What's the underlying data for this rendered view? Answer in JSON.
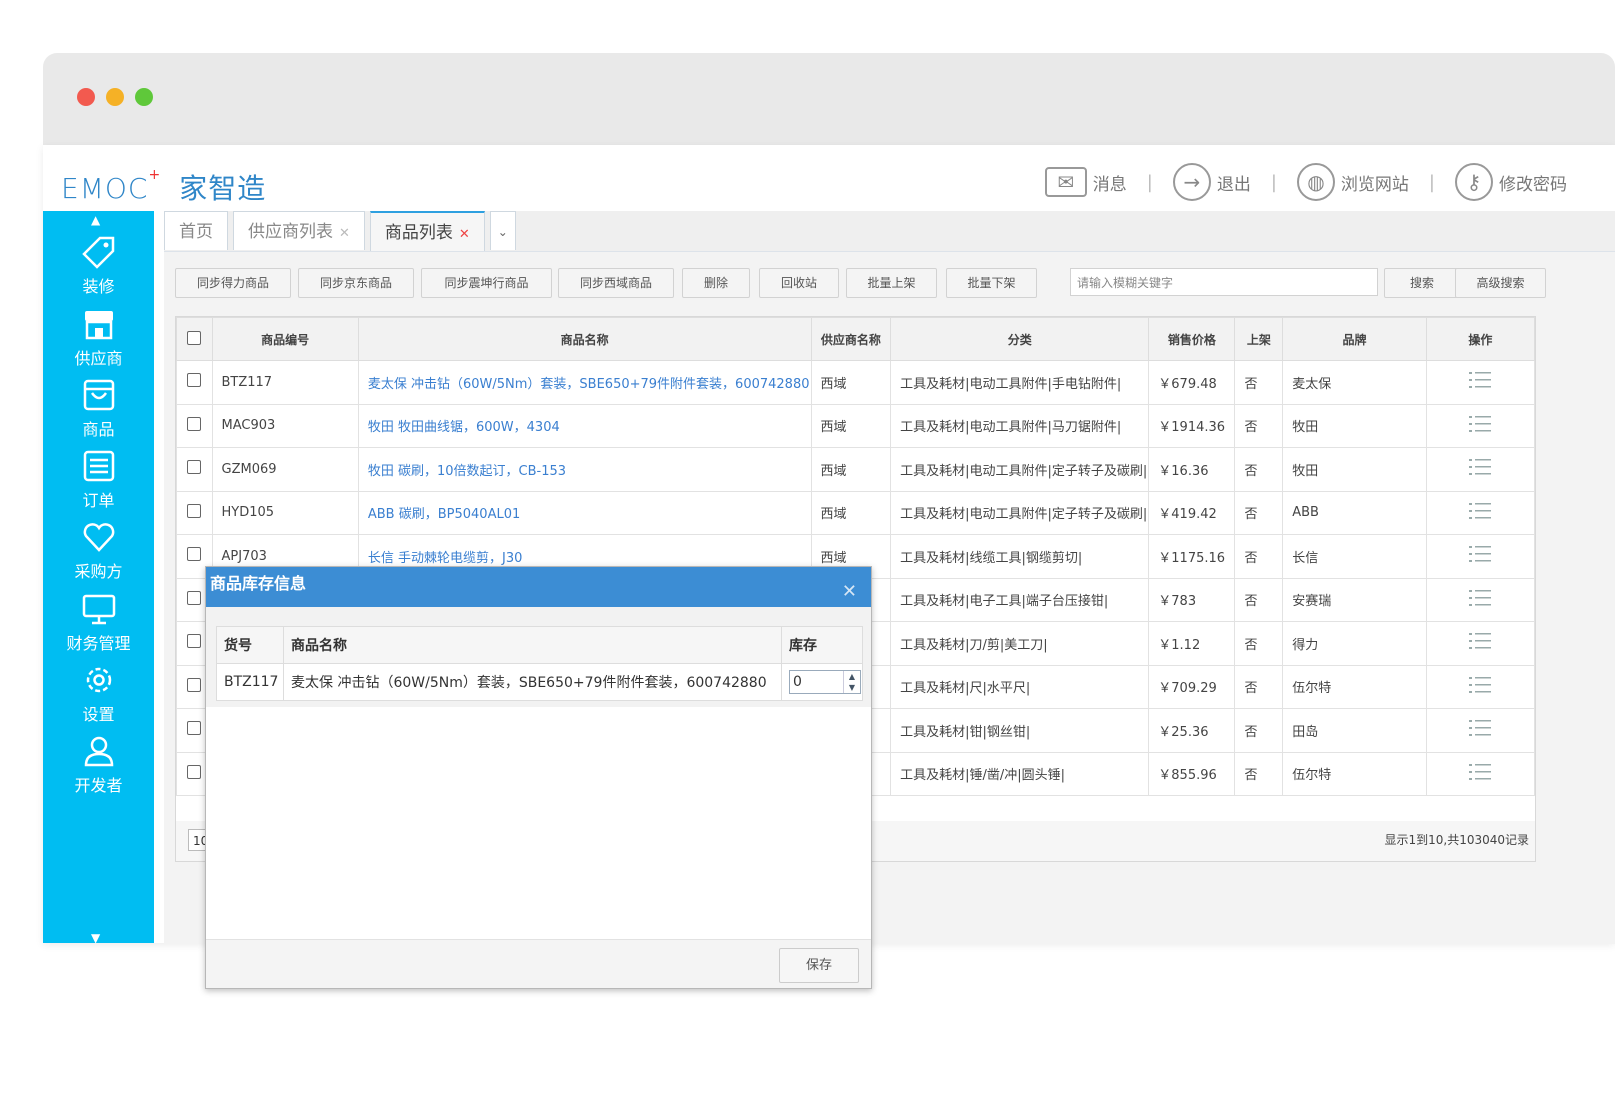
{
  "header": {
    "logo_text": "EMOC",
    "logo_cn": "家智造",
    "links": [
      {
        "label": "消息",
        "icon": "mail-icon"
      },
      {
        "label": "退出",
        "icon": "logout-icon"
      },
      {
        "label": "浏览网站",
        "icon": "dribbble-icon"
      },
      {
        "label": "修改密码",
        "icon": "key-icon"
      }
    ],
    "separator": "|"
  },
  "sidebar": {
    "items": [
      {
        "label": "装修",
        "icon": "tag-icon"
      },
      {
        "label": "供应商",
        "icon": "store-icon"
      },
      {
        "label": "商品",
        "icon": "bag-icon"
      },
      {
        "label": "订单",
        "icon": "list-icon"
      },
      {
        "label": "采购方",
        "icon": "heart-icon"
      },
      {
        "label": "财务管理",
        "icon": "monitor-icon"
      },
      {
        "label": "设置",
        "icon": "gear-icon"
      },
      {
        "label": "开发者",
        "icon": "user-icon"
      }
    ]
  },
  "tabs": [
    {
      "label": "首页",
      "closable": false
    },
    {
      "label": "供应商列表",
      "closable": true
    },
    {
      "label": "商品列表",
      "closable": true,
      "active": true
    }
  ],
  "toolbar": {
    "buttons": [
      "同步得力商品",
      "同步京东商品",
      "同步震坤行商品",
      "同步西域商品",
      "删除",
      "回收站",
      "批量上架",
      "批量下架"
    ],
    "search_placeholder": "请输入模糊关键字",
    "search_label": "搜索",
    "advanced_search_label": "高级搜索"
  },
  "grid": {
    "columns": [
      "商品编号",
      "商品名称",
      "供应商名称",
      "分类",
      "销售价格",
      "上架",
      "品牌",
      "操作"
    ],
    "rows": [
      {
        "code": "BTZ117",
        "name": "麦太保 冲击钻（60W/5Nm）套装，SBE650+79件附件套装，600742880",
        "supplier": "西域",
        "category": "工具及耗材|电动工具附件|手电钻附件|",
        "price": "￥679.48",
        "listed": "否",
        "brand": "麦太保"
      },
      {
        "code": "MAC903",
        "name": "牧田 牧田曲线锯，600W，4304",
        "supplier": "西域",
        "category": "工具及耗材|电动工具附件|马刀锯附件|",
        "price": "￥1914.36",
        "listed": "否",
        "brand": "牧田"
      },
      {
        "code": "GZM069",
        "name": "牧田 碳刷，10倍数起订，CB-153",
        "supplier": "西域",
        "category": "工具及耗材|电动工具附件|定子转子及碳刷|",
        "price": "￥16.36",
        "listed": "否",
        "brand": "牧田"
      },
      {
        "code": "HYD105",
        "name": "ABB 碳刷，BP5040AL01",
        "supplier": "西域",
        "category": "工具及耗材|电动工具附件|定子转子及碳刷|",
        "price": "￥419.42",
        "listed": "否",
        "brand": "ABB"
      },
      {
        "code": "APJ703",
        "name": "长信 手动棘轮电缆剪，J30",
        "supplier": "西域",
        "category": "工具及耗材|线缆工具|钢缆剪切|",
        "price": "￥1175.16",
        "listed": "否",
        "brand": "长信"
      },
      {
        "code": "",
        "name": "",
        "supplier": "",
        "category": "工具及耗材|电子工具|端子台压接钳|",
        "price": "￥783",
        "listed": "否",
        "brand": "安赛瑞"
      },
      {
        "code": "",
        "name": "",
        "supplier": "",
        "category": "工具及耗材|刀/剪|美工刀|",
        "price": "￥1.12",
        "listed": "否",
        "brand": "得力"
      },
      {
        "code": "",
        "name": "",
        "supplier": "",
        "category": "工具及耗材|尺|水平尺|",
        "price": "￥709.29",
        "listed": "否",
        "brand": "伍尔特"
      },
      {
        "code": "",
        "name": "",
        "supplier": "",
        "category": "工具及耗材|钳|钢丝钳|",
        "price": "￥25.36",
        "listed": "否",
        "brand": "田岛"
      },
      {
        "code": "",
        "name": "",
        "supplier": "",
        "category": "工具及耗材|锤/凿/冲|圆头锤|",
        "price": "￥855.96",
        "listed": "否",
        "brand": "伍尔特"
      }
    ],
    "page_size": "10",
    "page_info": "显示1到10,共103040记录"
  },
  "dialog": {
    "title": "商品库存信息",
    "columns": [
      "货号",
      "商品名称",
      "库存"
    ],
    "row": {
      "code": "BTZ117",
      "name": "麦太保 冲击钻（60W/5Nm）套装，SBE650+79件附件套装，600742880",
      "stock": "0"
    },
    "save_label": "保存"
  },
  "colors": {
    "sidebar": "#00bdf2",
    "dialog_title": "#3c8dd4",
    "link": "#3a7fd0",
    "price_header": "#7bbf3a"
  }
}
